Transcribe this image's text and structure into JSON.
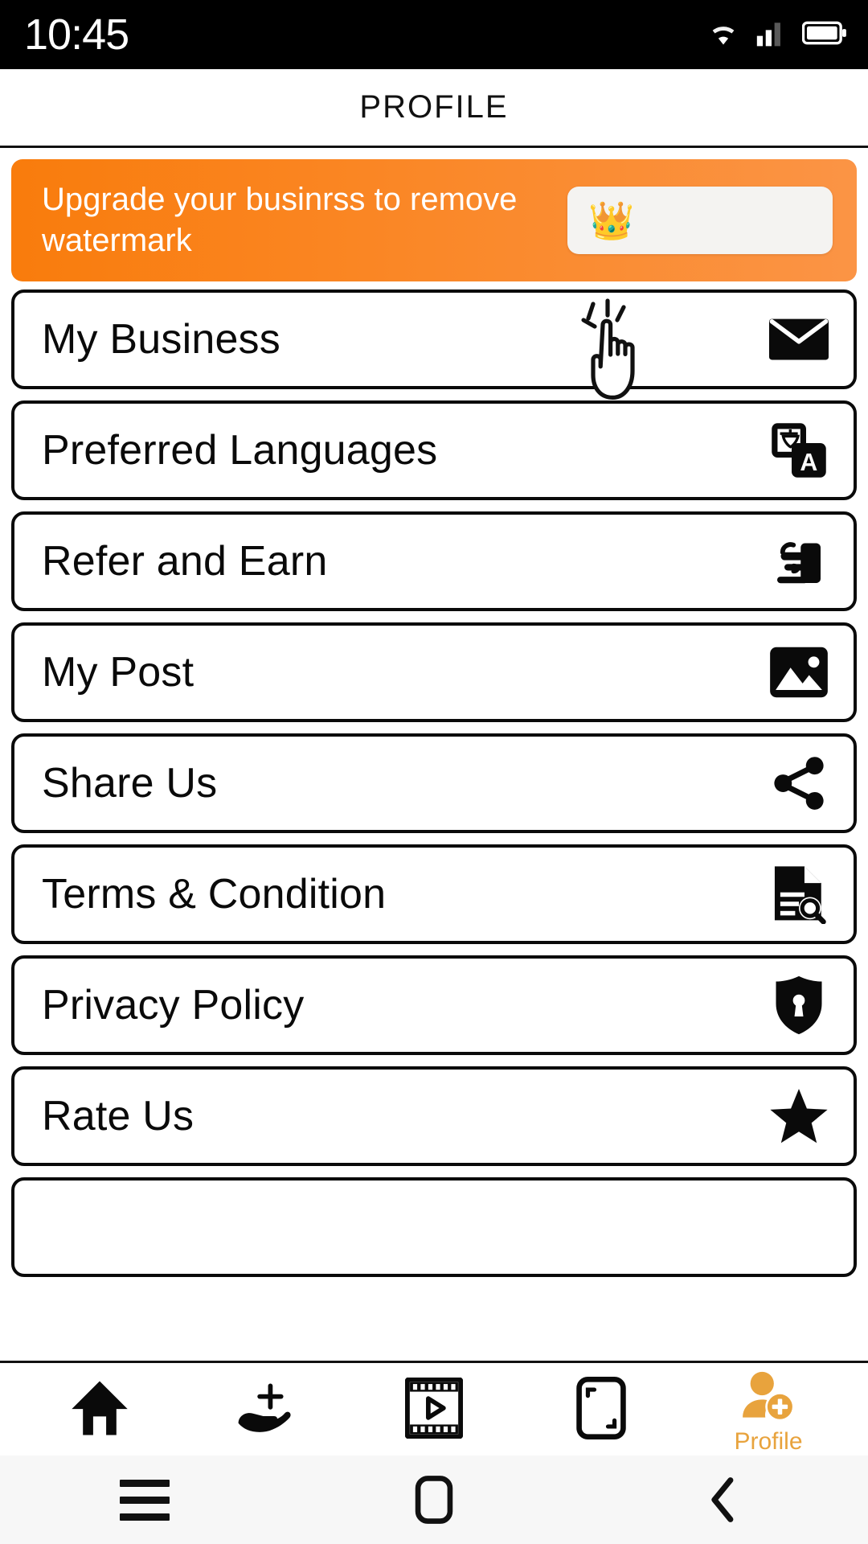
{
  "status_bar": {
    "time": "10:45",
    "icons": [
      "wifi-icon",
      "cellular-signal-icon",
      "battery-icon"
    ]
  },
  "header": {
    "title": "PROFILE"
  },
  "banner": {
    "message": "Upgrade your businrss to remove watermark",
    "cta_icon": "crown-icon",
    "cta_glyph": "👑",
    "color_start": "#F97C0C",
    "color_end": "#FB9445"
  },
  "menu": {
    "items": [
      {
        "label": "My Business",
        "icon": "envelope-icon"
      },
      {
        "label": "Preferred Languages",
        "icon": "translate-icon"
      },
      {
        "label": "Refer and Earn",
        "icon": "refer-earn-icon"
      },
      {
        "label": "My Post",
        "icon": "image-icon"
      },
      {
        "label": "Share Us",
        "icon": "share-icon"
      },
      {
        "label": "Terms & Condition",
        "icon": "document-search-icon"
      },
      {
        "label": "Privacy Policy",
        "icon": "shield-lock-icon"
      },
      {
        "label": "Rate Us",
        "icon": "star-icon"
      },
      {
        "label": "",
        "icon": ""
      }
    ]
  },
  "cursor": {
    "icon": "tap-hand-icon",
    "target": "My Business"
  },
  "tab_bar": {
    "active_color": "#E8A33D",
    "items": [
      {
        "label": "",
        "icon": "home-icon",
        "active": false
      },
      {
        "label": "",
        "icon": "hand-plus-icon",
        "active": false
      },
      {
        "label": "",
        "icon": "video-film-icon",
        "active": false
      },
      {
        "label": "",
        "icon": "frame-crop-icon",
        "active": false
      },
      {
        "label": "Profile",
        "icon": "profile-add-icon",
        "active": true
      }
    ]
  },
  "android_nav": {
    "items": [
      {
        "icon": "recents-menu-icon"
      },
      {
        "icon": "home-square-icon"
      },
      {
        "icon": "back-chevron-icon"
      }
    ]
  }
}
